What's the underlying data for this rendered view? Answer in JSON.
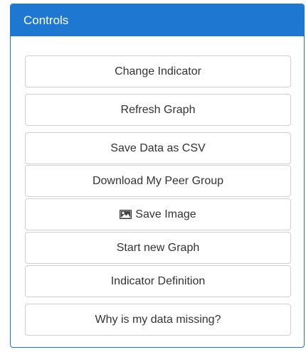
{
  "panel": {
    "title": "Controls"
  },
  "buttons": {
    "change_indicator": "Change Indicator",
    "refresh_graph": "Refresh Graph",
    "save_csv": "Save Data as CSV",
    "download_peer_group": "Download My Peer Group",
    "save_image": "Save Image",
    "start_new_graph": "Start new Graph",
    "indicator_definition": "Indicator Definition",
    "why_missing": "Why is my data missing?"
  },
  "icons": {
    "save_image_icon": "picture-icon"
  },
  "colors": {
    "heading_bg": "#1e78d2",
    "heading_text": "#ffffff",
    "button_border": "#cfcfcf",
    "button_text": "#333333"
  }
}
